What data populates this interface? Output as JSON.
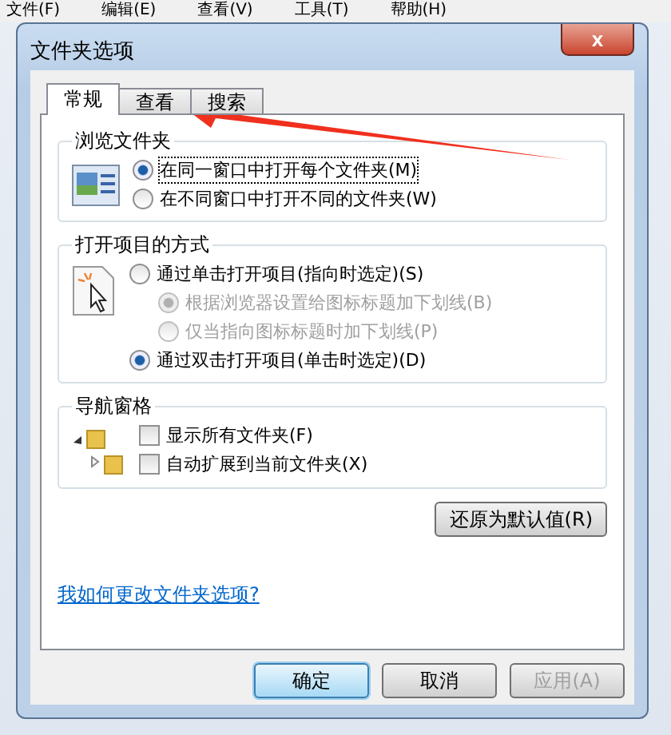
{
  "background_menu": [
    "文件(F)",
    "编辑(E)",
    "查看(V)",
    "工具(T)",
    "帮助(H)"
  ],
  "window": {
    "title": "文件夹选项",
    "close": "x"
  },
  "tabs": [
    {
      "label": "常规",
      "selected": true
    },
    {
      "label": "查看",
      "selected": false
    },
    {
      "label": "搜索",
      "selected": false
    }
  ],
  "groups": [
    {
      "title": "浏览文件夹",
      "options": [
        {
          "kind": "radio",
          "label": "在同一窗口中打开每个文件夹(M)",
          "checked": true,
          "disabled": false,
          "focused": true
        },
        {
          "kind": "radio",
          "label": "在不同窗口中打开不同的文件夹(W)",
          "checked": false,
          "disabled": false,
          "focused": false
        }
      ]
    },
    {
      "title": "打开项目的方式",
      "options": [
        {
          "kind": "radio",
          "label": "通过单击打开项目(指向时选定)(S)",
          "checked": false,
          "disabled": false,
          "focused": false
        },
        {
          "kind": "subradio",
          "label": "根据浏览器设置给图标标题加下划线(B)",
          "checked": true,
          "disabled": true,
          "focused": false
        },
        {
          "kind": "subradio",
          "label": "仅当指向图标标题时加下划线(P)",
          "checked": false,
          "disabled": true,
          "focused": false
        },
        {
          "kind": "radio",
          "label": "通过双击打开项目(单击时选定)(D)",
          "checked": true,
          "disabled": false,
          "focused": false
        }
      ]
    },
    {
      "title": "导航窗格",
      "options": [
        {
          "kind": "checkbox",
          "label": "显示所有文件夹(F)",
          "checked": false,
          "disabled": false,
          "focused": false
        },
        {
          "kind": "checkbox",
          "label": "自动扩展到当前文件夹(X)",
          "checked": false,
          "disabled": false,
          "focused": false
        }
      ]
    }
  ],
  "restore_button": "还原为默认值(R)",
  "help_link": "我如何更改文件夹选项?",
  "buttons": [
    {
      "label": "确定",
      "default": true,
      "disabled": false
    },
    {
      "label": "取消",
      "default": false,
      "disabled": false
    },
    {
      "label": "应用(A)",
      "default": false,
      "disabled": true
    }
  ]
}
